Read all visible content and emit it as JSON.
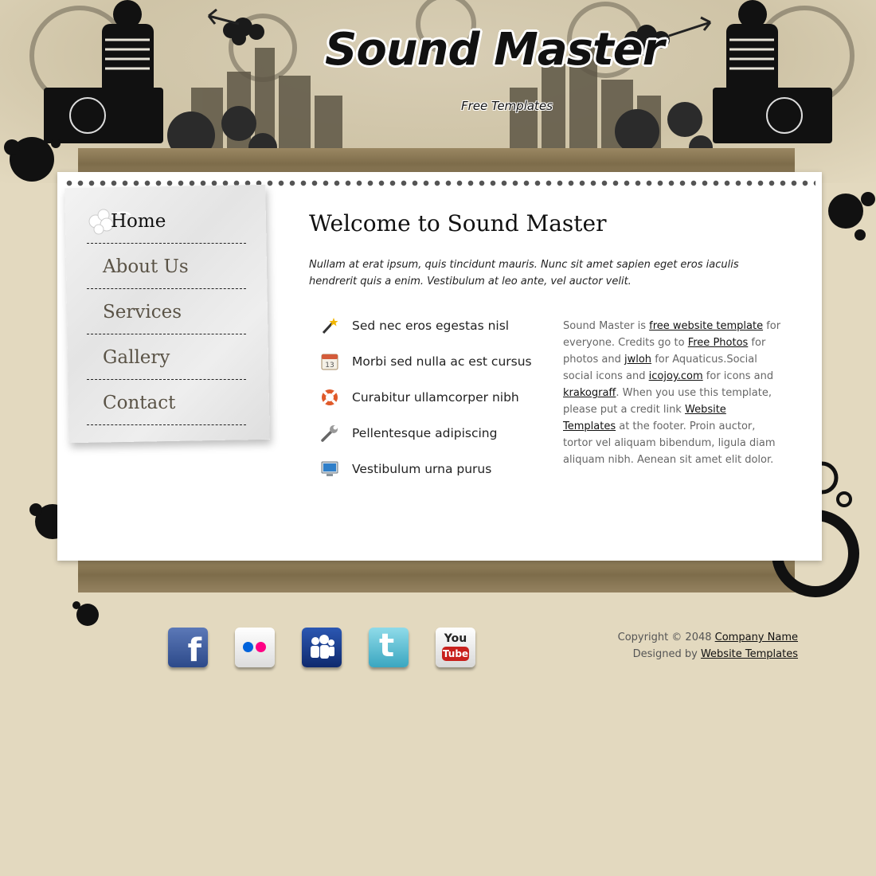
{
  "header": {
    "logo_text": "Sound Master",
    "tagline": "Free Templates"
  },
  "nav": {
    "items": [
      {
        "label": "Home",
        "active": true
      },
      {
        "label": "About Us"
      },
      {
        "label": "Services"
      },
      {
        "label": "Gallery"
      },
      {
        "label": "Contact"
      }
    ]
  },
  "main": {
    "title": "Welcome to Sound Master",
    "intro": "Nullam at erat ipsum, quis tincidunt mauris. Nunc sit amet sapien eget eros iaculis hendrerit quis a enim. Vestibulum at leo ante, vel auctor velit.",
    "features": [
      {
        "icon": "magic-wand-icon",
        "text": "Sed nec eros egestas nisl"
      },
      {
        "icon": "calendar-icon",
        "calendar_day": "13",
        "text": "Morbi sed nulla ac est cursus"
      },
      {
        "icon": "lifebuoy-icon",
        "text": "Curabitur ullamcorper nibh"
      },
      {
        "icon": "wrench-icon",
        "text": "Pellentesque adipiscing"
      },
      {
        "icon": "monitor-icon",
        "text": "Vestibulum urna purus"
      }
    ],
    "credits": {
      "t1": "Sound Master is ",
      "l1": "free website template",
      "t2": " for everyone. Credits go to ",
      "l2": "Free Photos",
      "t3": " for photos and ",
      "l3": "jwloh",
      "t4": " for Aquaticus.Social social icons and ",
      "l4": "icojoy.com",
      "t5": " for icons and ",
      "l5": "krakograff",
      "t6": ". When you use this template, please put a credit link ",
      "l6": "Website Templates",
      "t7": " at the footer. Proin auctor, tortor vel aliquam bibendum, ligula diam aliquam nibh. Aenean sit amet elit dolor."
    }
  },
  "footer": {
    "social": [
      {
        "name": "facebook",
        "glyph": "f",
        "color": "#3b5998"
      },
      {
        "name": "flickr",
        "color": "#f0f0f0"
      },
      {
        "name": "myspace",
        "color": "#1c3d8a"
      },
      {
        "name": "twitter",
        "glyph": "t",
        "color": "#5fc4d8"
      },
      {
        "name": "youtube",
        "glyph_top": "You",
        "glyph_bottom": "Tube",
        "color": "#eeeeee"
      }
    ],
    "copyright_prefix": "Copyright © 2048 ",
    "company_link": "Company Name",
    "designed_prefix": "Designed by ",
    "designer_link": "Website Templates"
  },
  "colors": {
    "background": "#e3d9bf",
    "cardboard": "#8b7a55",
    "panel": "#ffffff",
    "nav_text": "#5a5346"
  }
}
